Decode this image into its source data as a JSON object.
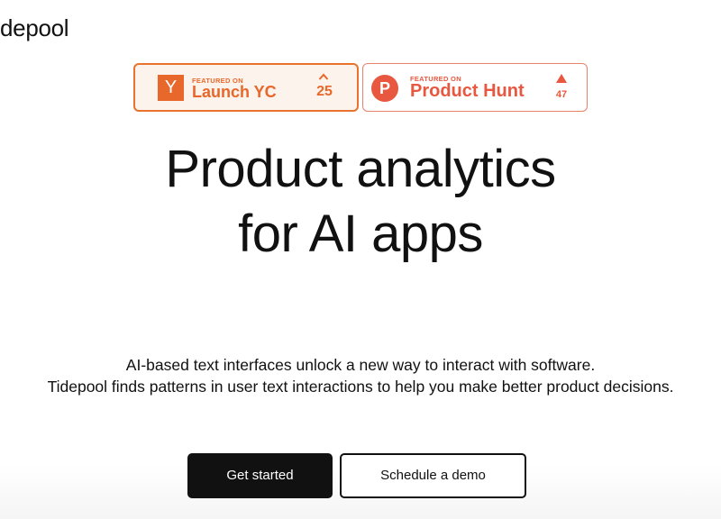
{
  "header": {
    "logo_text": "depool"
  },
  "badges": {
    "yc": {
      "logo_letter": "Y",
      "featured": "FEATURED ON",
      "name": "Launch YC",
      "votes": "25",
      "color": "#e8672a"
    },
    "ph": {
      "logo_letter": "P",
      "featured": "FEATURED ON",
      "name": "Product Hunt",
      "votes": "47",
      "color": "#e8573f"
    }
  },
  "hero": {
    "title_line1": "Product analytics",
    "title_line2": "for AI apps",
    "subtitle_line1": "AI-based text interfaces unlock a new way to interact with software.",
    "subtitle_line2": "Tidepool finds patterns in user text interactions to help you make better product decisions."
  },
  "actions": {
    "primary_label": "Get started",
    "secondary_label": "Schedule a demo"
  }
}
